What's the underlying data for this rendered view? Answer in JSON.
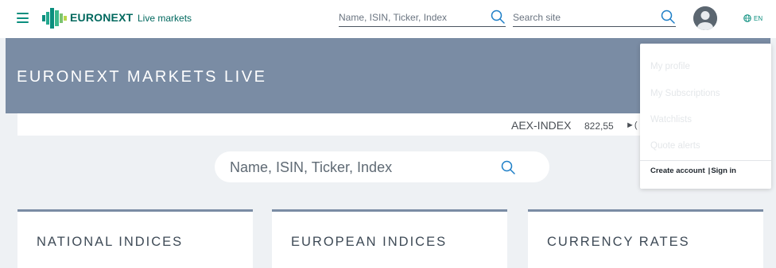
{
  "header": {
    "brand": "EURONEXT",
    "subtitle": "Live markets",
    "search_placeholder_1": "Name, ISIN, Ticker, Index",
    "search_placeholder_2": "Search site",
    "language": "EN"
  },
  "banner": {
    "title": "EURONEXT MARKETS LIVE"
  },
  "ticker": {
    "name": "AEX-INDEX",
    "value": "822,55",
    "change_partial": "►("
  },
  "main_search": {
    "placeholder": "Name, ISIN, Ticker, Index"
  },
  "cards": [
    {
      "title": "NATIONAL INDICES"
    },
    {
      "title": "EUROPEAN INDICES"
    },
    {
      "title": "CURRENCY RATES"
    }
  ],
  "account_menu": {
    "items": [
      "My profile",
      "My Subscriptions",
      "Watchlists",
      "Quote alerts"
    ],
    "create_account": "Create account",
    "separator": "|",
    "sign_in": "Sign in"
  },
  "colors": {
    "brand_green": "#00685e",
    "accent_teal": "#0a8e7e",
    "banner_bg": "#7a8ca4",
    "page_bg": "#eef1f4",
    "menu_disabled_text": "#e4e7ea"
  },
  "icons": [
    "menu-icon",
    "euronext-logo-icon",
    "search-icon",
    "user-avatar-icon",
    "globe-icon"
  ]
}
